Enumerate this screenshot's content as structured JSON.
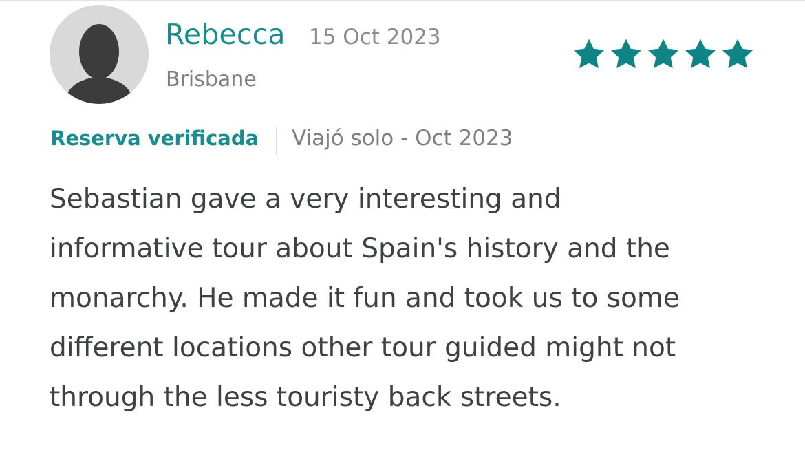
{
  "reviewer": {
    "name": "Rebecca",
    "date": "15 Oct 2023",
    "location": "Brisbane"
  },
  "rating": {
    "value": 5,
    "max": 5,
    "star_color": "#0f8487"
  },
  "verification": {
    "label": "Reserva verificada",
    "trip": "Viajó solo - Oct 2023"
  },
  "review": {
    "lines": [
      "Sebastian gave a very interesting and",
      "informative tour about Spain's history and the",
      "monarchy. He made it fun and took us to some",
      "different locations other tour guided might not",
      "through the less touristy back streets."
    ]
  },
  "colors": {
    "accent": "#1a8c8e",
    "text": "#3f4043",
    "muted": "#7d7e82"
  }
}
